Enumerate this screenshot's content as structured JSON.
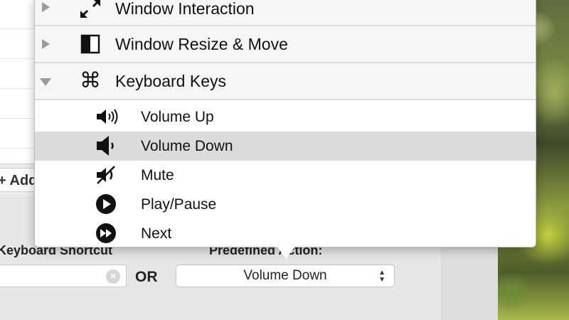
{
  "background": {
    "add_button_label": "+ Add",
    "shortcut_label": "Keyboard Shortcut",
    "or_label": "OR",
    "predefined_label": "Predefined Action:",
    "selected_action": "Volume Down"
  },
  "menu": {
    "categories": [
      {
        "label": "Window Interaction",
        "icon": "diagonal-arrows-icon",
        "expanded": false
      },
      {
        "label": "Window Resize & Move",
        "icon": "half-window-icon",
        "expanded": false
      },
      {
        "label": "Keyboard Keys",
        "icon": "command-key-icon",
        "expanded": true
      }
    ],
    "items": [
      {
        "label": "Volume Up",
        "icon": "volume-up-icon"
      },
      {
        "label": "Volume Down",
        "icon": "volume-down-icon",
        "selected": true
      },
      {
        "label": "Mute",
        "icon": "mute-icon"
      },
      {
        "label": "Play/Pause",
        "icon": "play-icon"
      },
      {
        "label": "Next",
        "icon": "next-icon"
      }
    ]
  },
  "colors": {
    "selection": "#dcdcdc",
    "category_bg": "#f6f6f6"
  }
}
